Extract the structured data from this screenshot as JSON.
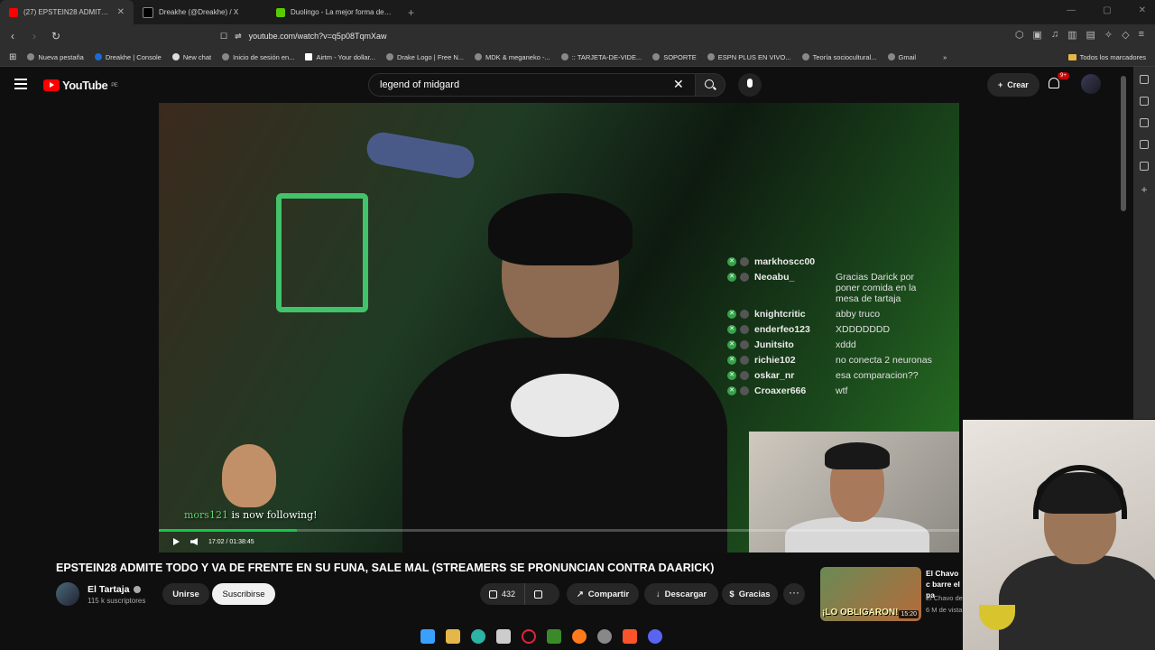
{
  "browser": {
    "tabs": [
      {
        "title": "(27) EPSTEIN28 ADMITE TODO",
        "color": "#ff0000",
        "active": true
      },
      {
        "title": "Dreakhe (@Dreakhe) / X",
        "color": "#000000",
        "active": false
      },
      {
        "title": "Duolingo - La mejor forma de aprender",
        "color": "#58cc02",
        "active": false
      }
    ],
    "url": "youtube.com/watch?v=q5p08TqmXaw",
    "bookmarks": [
      "Nueva pestaña",
      "Dreakhe | Console",
      "New chat",
      "Inicio de sesión en...",
      "Airtm - Your dollar...",
      "Drake Logo | Free N...",
      "MDK & meganeko -...",
      ":: TARJETA-DE-VIDE...",
      "SOPORTE",
      "ESPN PLUS EN VIVO...",
      "Teoría sociocultural...",
      "Gmail"
    ],
    "bookmarks_all": "Todos los marcadores"
  },
  "youtube": {
    "logo_text": "YouTube",
    "logo_region": "PE",
    "search_value": "legend of midgard",
    "create_label": "Crear",
    "notif_badge": "9+"
  },
  "video": {
    "chat": [
      {
        "user": "markhoscc00",
        "msg": ""
      },
      {
        "user": "Neoabu_",
        "msg": "Gracias Darick por poner comida en la mesa de tartaja"
      },
      {
        "user": "knightcritic",
        "msg": "abby truco"
      },
      {
        "user": "enderfeo123",
        "msg": "XDDDDDDD"
      },
      {
        "user": "Junitsito",
        "msg": "xddd"
      },
      {
        "user": "richie102",
        "msg": "no conecta 2 neuronas"
      },
      {
        "user": "oskar_nr",
        "msg": "esa comparacion??"
      },
      {
        "user": "Croaxer666",
        "msg": "wtf"
      }
    ],
    "follow_name": "mors121",
    "follow_text": "is now following!",
    "time_current": "17:02",
    "time_total": "01:38:45",
    "progress": 0.173
  },
  "meta": {
    "title": "EPSTEIN28 ADMITE TODO Y VA DE FRENTE EN SU FUNA, SALE MAL (STREAMERS SE PRONUNCIAN CONTRA DAARICK)",
    "channel": "El Tartaja",
    "subscribers": "115 k suscriptores",
    "join_label": "Unirse",
    "subscribe_label": "Suscribirse",
    "likes": "432",
    "share_label": "Compartir",
    "download_label": "Descargar",
    "thanks_label": "Gracias",
    "more_label": "···"
  },
  "recommendation": {
    "caption": "¡LO OBLIGARON!",
    "duration": "15:20",
    "title": "El Chavo c barre el pa",
    "channel": "El Chavo de",
    "views": "6 M de vista"
  }
}
